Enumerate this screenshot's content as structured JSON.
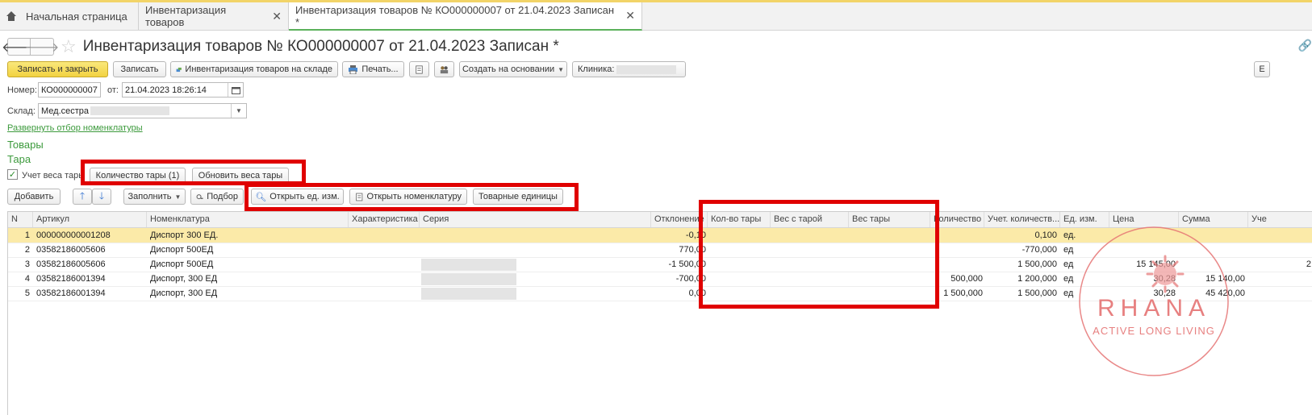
{
  "tabs": [
    {
      "label": "Начальная страница"
    },
    {
      "label": "Инвентаризация товаров"
    },
    {
      "label": "Инвентаризация товаров № КО000000007 от 21.04.2023 Записан *"
    }
  ],
  "header": {
    "title": "Инвентаризация товаров № КО000000007 от 21.04.2023 Записан *"
  },
  "toolbar": {
    "save_close": "Записать и закрыть",
    "save": "Записать",
    "inventory_warehouse": "Инвентаризация товаров на складе",
    "print": "Печать...",
    "create_based": "Создать на основании",
    "clinic": "Клиника:",
    "right_edge": "Е"
  },
  "form": {
    "number_label": "Номер:",
    "number_value": "КО000000007",
    "from_label": "от:",
    "date_value": "21.04.2023 18:26:14",
    "warehouse_label": "Склад:",
    "warehouse_value": "Мед.сестра",
    "expand_filter": "Развернуть отбор номенклатуры"
  },
  "sections": {
    "goods": "Товары",
    "tare": "Тара"
  },
  "tare_row": {
    "checkbox_label": "Учет веса тары",
    "checkbox_checked": true,
    "tare_qty_button": "Количество тары (1)",
    "update_weights_button": "Обновить веса тары"
  },
  "table_toolbar": {
    "add": "Добавить",
    "fill": "Заполнить",
    "select": "Подбор",
    "open_unit": "Открыть ед. изм.",
    "open_nomenclature": "Открыть номенклатуру",
    "goods_units": "Товарные единицы"
  },
  "table": {
    "columns": [
      "N",
      "Артикул",
      "Номенклатура",
      "Характеристика",
      "Серия",
      "Отклонение",
      "Кол-во тары",
      "Вес с тарой",
      "Вес тары",
      "Количество",
      "Учет. количеств...",
      "Ед. изм.",
      "Цена",
      "Сумма",
      "Уче"
    ],
    "rows": [
      {
        "n": "1",
        "article": "000000000001208",
        "nom": "Диспорт 300 ЕД.",
        "dev": "-0,10",
        "qty": "",
        "acc": "0,100",
        "unit": "ед.",
        "price": "",
        "sum": "",
        "extra": ""
      },
      {
        "n": "2",
        "article": "03582186005606",
        "nom": "Диспорт 500ЕД",
        "dev": "770,00",
        "qty": "",
        "acc": "-770,000",
        "unit": "ед",
        "price": "",
        "sum": "",
        "extra": ""
      },
      {
        "n": "3",
        "article": "03582186005606",
        "nom": "Диспорт 500ЕД",
        "dev": "-1 500,00",
        "qty": "",
        "acc": "1 500,000",
        "unit": "ед",
        "price": "15 145,00",
        "sum": "",
        "extra": "2"
      },
      {
        "n": "4",
        "article": "03582186001394",
        "nom": "Диспорт, 300 ЕД",
        "dev": "-700,00",
        "qty": "500,000",
        "acc": "1 200,000",
        "unit": "ед",
        "price": "30,28",
        "sum": "15 140,00",
        "extra": ""
      },
      {
        "n": "5",
        "article": "03582186001394",
        "nom": "Диспорт, 300 ЕД",
        "dev": "0,00",
        "qty": "1 500,000",
        "acc": "1 500,000",
        "unit": "ед",
        "price": "30,28",
        "sum": "45 420,00",
        "extra": ""
      }
    ],
    "selected_row": 1
  },
  "watermark": {
    "brand": "RHANA",
    "tagline": "ACTIVE LONG LIVING",
    "color": "#e57373"
  },
  "colors": {
    "accent_green": "#3c9a3c",
    "highlight_red": "#e00000",
    "primary_yellow": "#f2d241",
    "row_selected": "#fbeaa8"
  }
}
